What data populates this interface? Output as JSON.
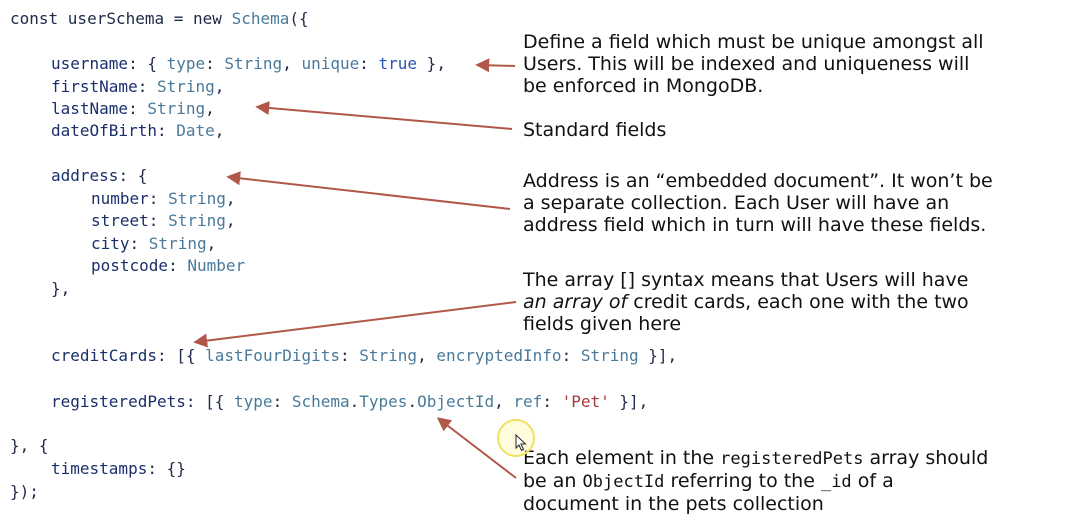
{
  "code": {
    "l1": {
      "a": "const userSchema = new ",
      "b": "Schema",
      "c": "({"
    },
    "l2": {
      "a": "username",
      "b": ": { ",
      "c": "type",
      "d": ": ",
      "e": "String",
      "f": ", ",
      "g": "unique",
      "h": ": ",
      "i": "true",
      "j": " },"
    },
    "l3": {
      "a": "firstName",
      "b": ": ",
      "c": "String",
      "d": ","
    },
    "l4": {
      "a": "lastName",
      "b": ": ",
      "c": "String",
      "d": ","
    },
    "l5": {
      "a": "dateOfBirth",
      "b": ": ",
      "c": "Date",
      "d": ","
    },
    "l6": {
      "a": "address",
      "b": ": {"
    },
    "l7": {
      "a": "number",
      "b": ": ",
      "c": "String",
      "d": ","
    },
    "l8": {
      "a": "street",
      "b": ": ",
      "c": "String",
      "d": ","
    },
    "l9": {
      "a": "city",
      "b": ": ",
      "c": "String",
      "d": ","
    },
    "l10": {
      "a": "postcode",
      "b": ": ",
      "c": "Number"
    },
    "l11": {
      "a": "},"
    },
    "l12": {
      "a": "creditCards",
      "b": ": [{ ",
      "c": "lastFourDigits",
      "d": ": ",
      "e": "String",
      "f": ", ",
      "g": "encryptedInfo",
      "h": ": ",
      "i": "String",
      "j": " }],"
    },
    "l13": {
      "a": "registeredPets",
      "b": ": [{ ",
      "c": "type",
      "d": ": ",
      "e": "Schema",
      "f": ".",
      "g": "Types",
      "h": ".",
      "i": "ObjectId",
      "j": ", ",
      "k": "ref",
      "l": ": ",
      "m": "'Pet'",
      "n": " }],"
    },
    "l14": {
      "a": "}, {"
    },
    "l15": {
      "a": "timestamps",
      "b": ": {}"
    },
    "l16": {
      "a": "});"
    }
  },
  "notes": {
    "unique": [
      "Define a field which must be unique amongst all",
      "Users. This will be indexed and uniqueness will",
      "be enforced in MongoDB."
    ],
    "standard": "Standard fields",
    "address": [
      "Address is an “embedded document”. It won’t be",
      "a separate collection. Each User will have an",
      "address field which in turn will have these fields."
    ],
    "array": {
      "l1": "The array [] syntax means that Users will have",
      "l2_em": "an array of",
      "l2_rest": " credit cards, each one with the two",
      "l3": "fields given here"
    },
    "objectid": {
      "l1_a": "Each element in the ",
      "l1_code": "registeredPets",
      "l1_b": " array should",
      "l2_a": "be an ",
      "l2_code1": "ObjectId",
      "l2_b": " referring to the ",
      "l2_code2": "_id",
      "l2_c": " of a",
      "l3": "document in the pets collection"
    }
  },
  "colors": {
    "arrow": "#b0574a",
    "code_text": "#1f2a4a",
    "code_type": "#4a7a9a",
    "code_literal": "#2a55b0",
    "code_string": "#a33a3a"
  }
}
